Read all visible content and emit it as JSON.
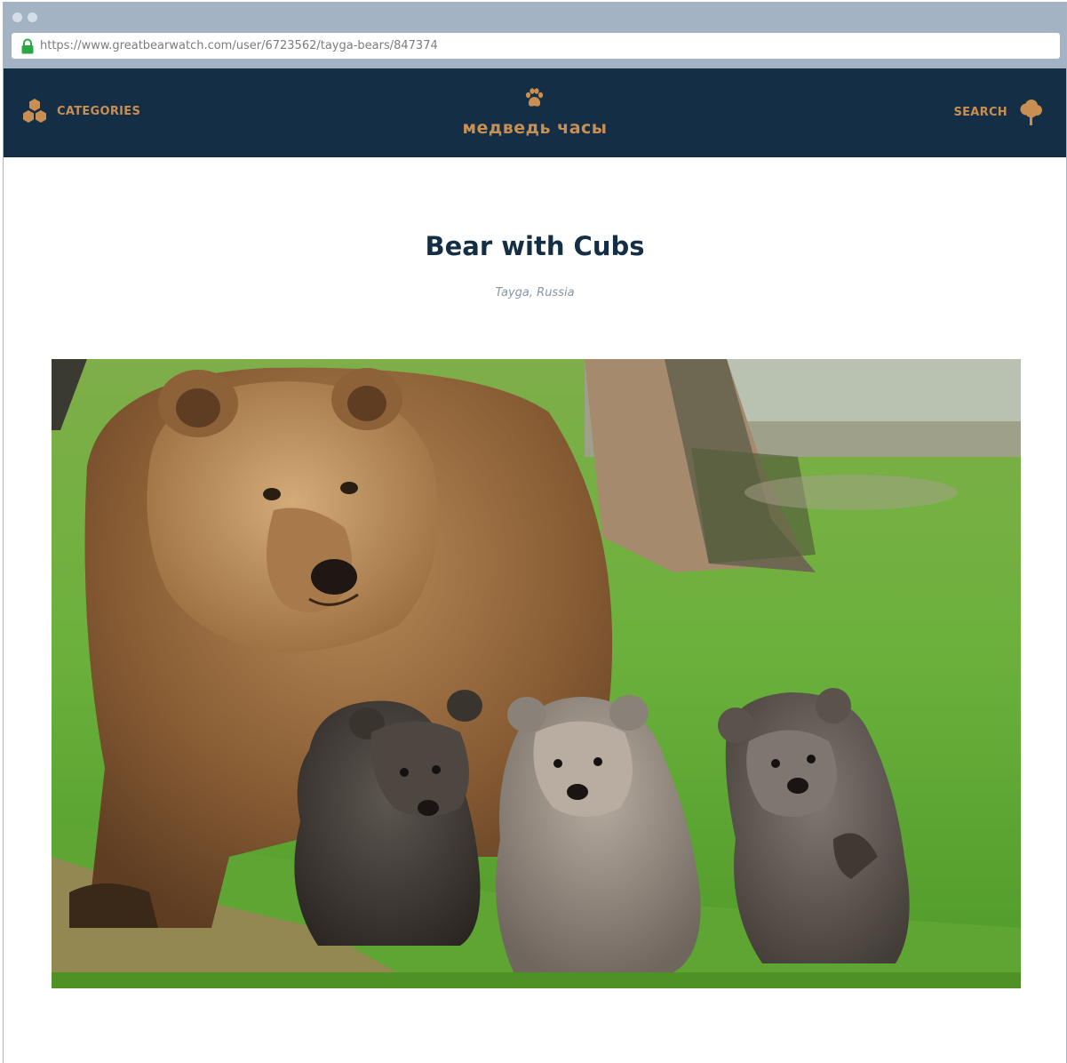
{
  "browser": {
    "url": "https://www.greatbearwatch.com/user/6723562/tayga-bears/847374"
  },
  "nav": {
    "categories_label": "CATEGORIES",
    "brand_name": "медведь часы",
    "search_label": "SEARCH"
  },
  "article": {
    "title": "Bear with Cubs",
    "location": "Tayga, Russia"
  },
  "colors": {
    "navbar_bg": "#142e45",
    "accent": "#c98e52",
    "chrome": "#a4b3c4"
  },
  "icons": [
    "lock-icon",
    "hexagons-icon",
    "paw-icon",
    "tree-icon"
  ]
}
